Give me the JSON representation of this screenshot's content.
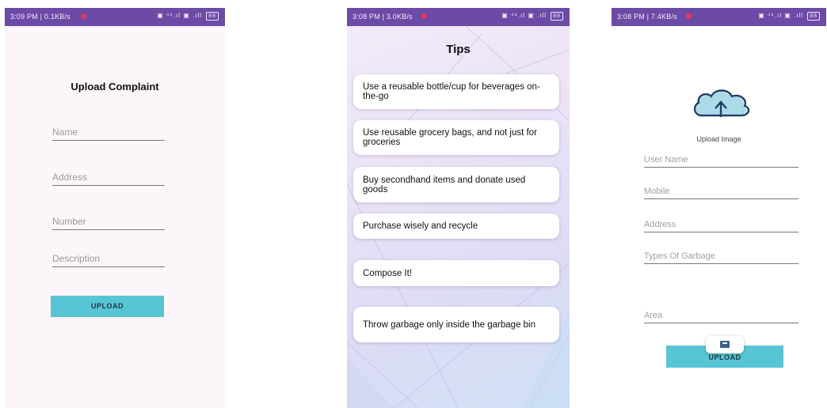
{
  "complaint_screen": {
    "status": {
      "time": "3:09 PM | 0.1KB/s",
      "battery": "88"
    },
    "title": "Upload Complaint",
    "fields": {
      "name_placeholder": "Name",
      "address_placeholder": "Address",
      "number_placeholder": "Number",
      "description_placeholder": "Description"
    },
    "upload_button": "UPLOAD"
  },
  "tips_screen": {
    "status": {
      "time": "3:08 PM | 3.0KB/s",
      "battery": "88"
    },
    "title": "Tips",
    "tips": [
      "Use a reusable bottle/cup for beverages on-the-go",
      "Use reusable grocery bags, and not just for groceries",
      "Buy secondhand items and donate used goods",
      "Purchase wisely and recycle",
      "Compose It!",
      "Throw garbage only inside the garbage bin"
    ]
  },
  "garbage_screen": {
    "status": {
      "time": "3:08 PM | 7.4KB/s",
      "battery": "88"
    },
    "upload_image_label": "Upload Image",
    "upload_icon": "cloud-upload-icon",
    "fields": {
      "user_name_placeholder": "User Name",
      "mobile_placeholder": "Mobile",
      "address_placeholder": "Address",
      "types_placeholder": "Types Of Garbage",
      "area_placeholder": "Area"
    },
    "upload_button": "UPLOAD",
    "fab_icon": "image-icon"
  },
  "colors": {
    "status_bar": "#6c4ba6",
    "button": "#58c5d4",
    "record_dot": "#e8365a"
  }
}
